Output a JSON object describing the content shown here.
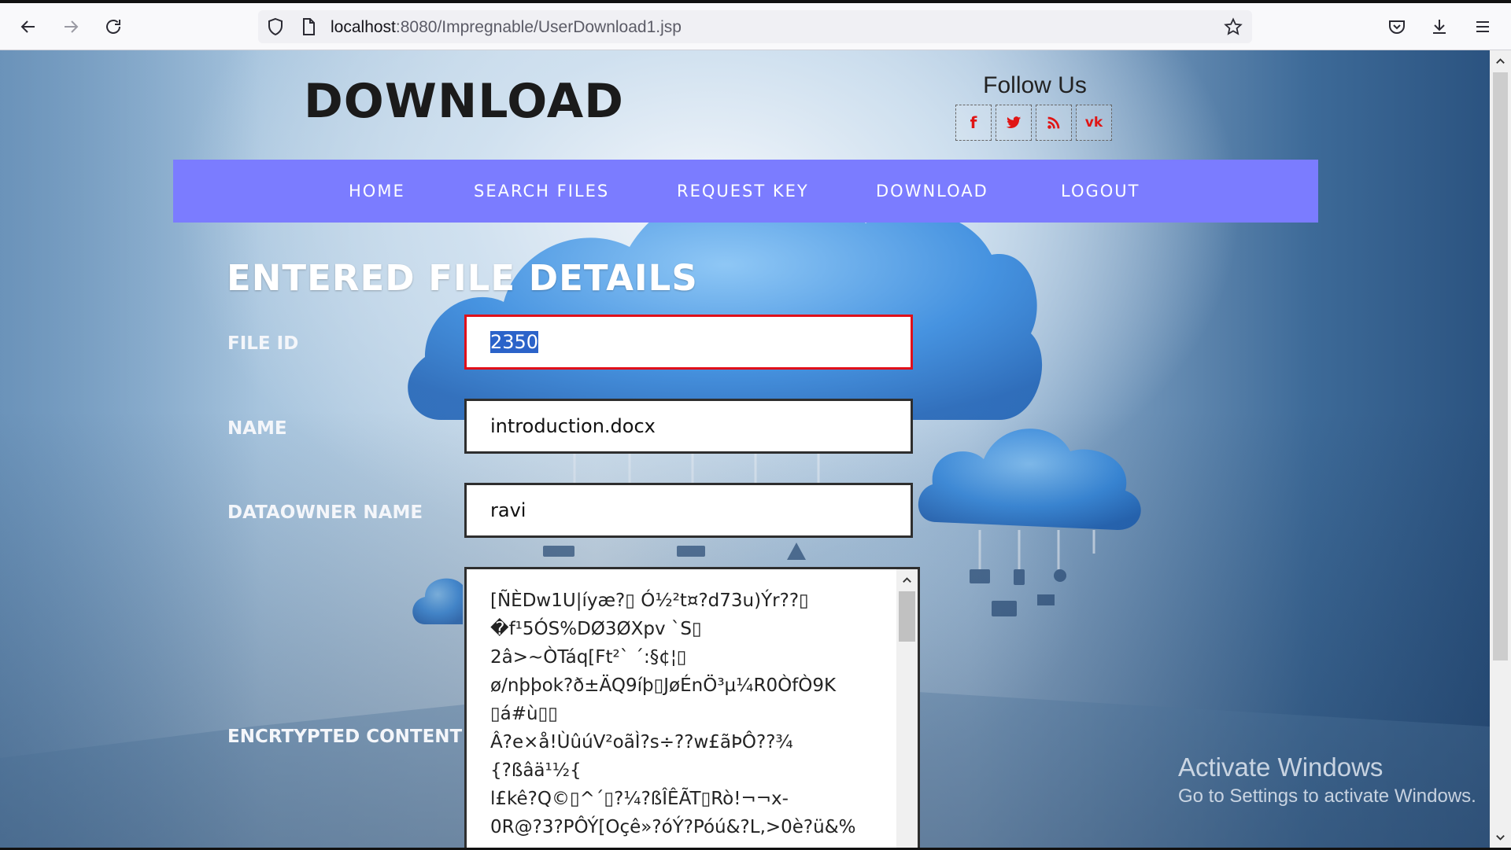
{
  "browser": {
    "url_host": "localhost",
    "url_path": ":8080/Impregnable/UserDownload1.jsp"
  },
  "header": {
    "brand": "DOWNLOAD",
    "follow_title": "Follow Us",
    "social": [
      {
        "name": "facebook",
        "glyph": "f"
      },
      {
        "name": "twitter",
        "glyph": "twitter-icon"
      },
      {
        "name": "rss",
        "glyph": "rss-icon"
      },
      {
        "name": "vk",
        "glyph": "vk"
      }
    ]
  },
  "nav": {
    "items": [
      "HOME",
      "SEARCH FILES",
      "REQUEST KEY",
      "DOWNLOAD",
      "LOGOUT"
    ],
    "color": "#7b7cff"
  },
  "form": {
    "title": "ENTERED FILE DETAILS",
    "file_id_label": "FILE ID",
    "file_id_value": "2350",
    "name_label": "NAME",
    "name_value": "introduction.docx",
    "owner_label": "DATAOWNER NAME",
    "owner_value": "ravi",
    "content_label": "ENCRTYPTED CONTENT",
    "content_value": "[ÑÈDw1U|íyæ?▯ Ó½²t¤?d73u)Ýr??▯\n�f¹5ÓS%DØ3ØXpv `S▯\n2â>~ÒTáq[Ft²` ´:§¢¦▯\nø/nþþok?ð±ÄQ9íþ▯JøÉnÖ³µ¼R0ÒfÒ9K\n▯á#ù▯▯\nÂ?e×å!ÙûúV²oãÌ?s÷??w£ãÞÔ??¾\n{?ßâä¹½{\nl£kê?Q©▯^´▯?¼?ßÎÊÃT▯Rò!¬¬x-\n0R@?3?PÔÝ[Oçê»?óÝ?Póú&?L,>0è?ü&%"
  },
  "watermark": {
    "line1": "Activate Windows",
    "line2": "Go to Settings to activate Windows."
  }
}
